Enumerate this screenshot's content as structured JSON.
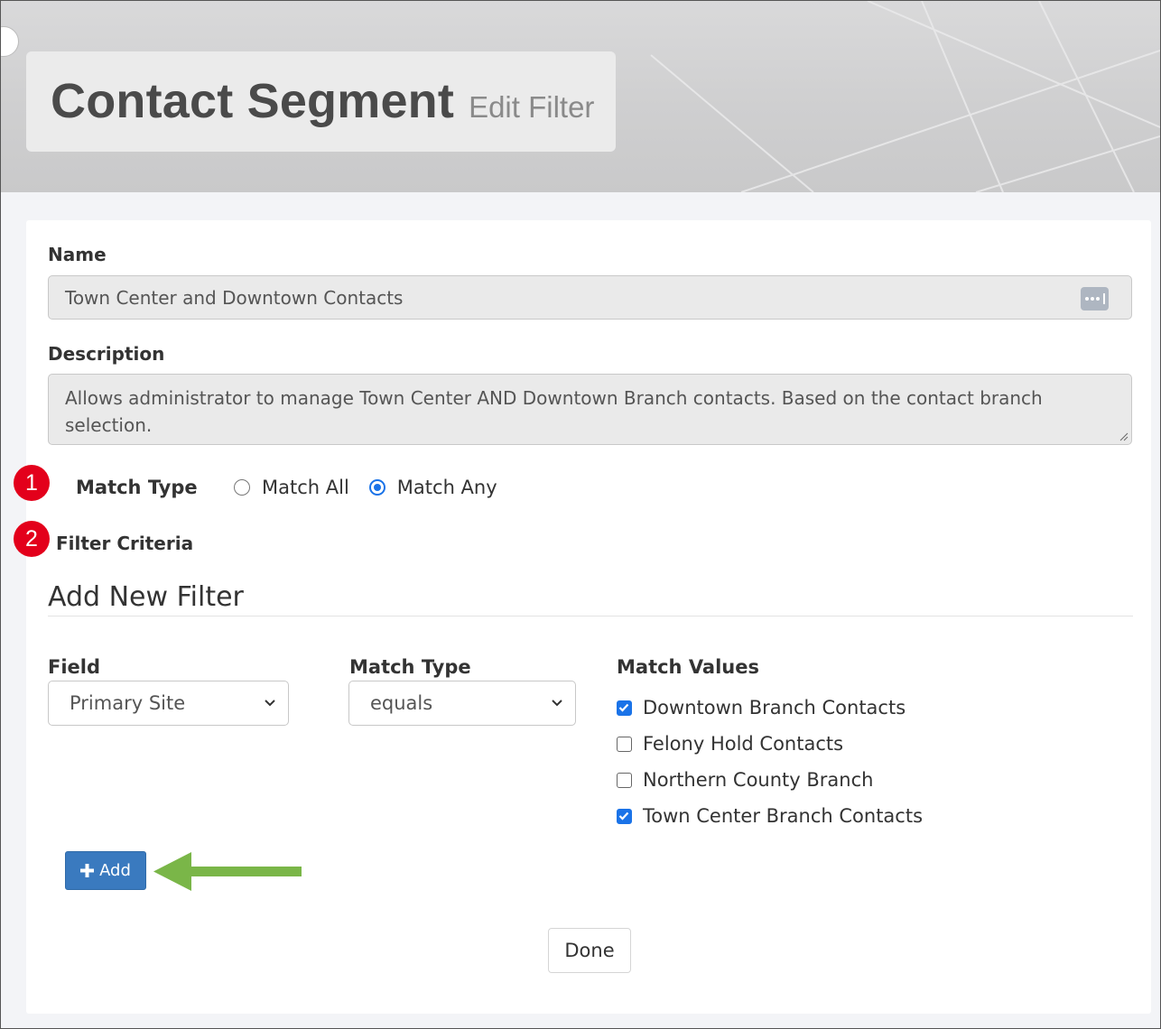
{
  "header": {
    "title": "Contact Segment",
    "subtitle": "Edit Filter"
  },
  "form": {
    "name_label": "Name",
    "name_value": "Town Center and Downtown Contacts",
    "description_label": "Description",
    "description_value": "Allows administrator to manage Town Center AND Downtown Branch contacts. Based on the contact branch selection.",
    "match_type_label": "Match Type",
    "match_type_options": [
      {
        "label": "Match All",
        "checked": false
      },
      {
        "label": "Match Any",
        "checked": true
      }
    ],
    "filter_criteria_label": "Filter Criteria"
  },
  "badges": [
    "1",
    "2"
  ],
  "new_filter": {
    "heading": "Add New Filter",
    "field_label": "Field",
    "field_value": "Primary Site",
    "match_type_label": "Match Type",
    "match_type_value": "equals",
    "match_values_label": "Match Values",
    "match_values": [
      {
        "label": "Downtown Branch Contacts",
        "checked": true
      },
      {
        "label": "Felony Hold Contacts",
        "checked": false
      },
      {
        "label": "Northern County Branch",
        "checked": false
      },
      {
        "label": "Town Center Branch Contacts",
        "checked": true
      }
    ],
    "add_label": "Add"
  },
  "footer": {
    "done_label": "Done"
  },
  "colors": {
    "accent": "#1a73e8",
    "badge": "#e3001b",
    "add_button": "#3a7abf",
    "arrow": "#7ab648"
  },
  "icons": [
    "password-manager-icon",
    "chevron-down-icon",
    "plus-icon",
    "resize-grip-icon",
    "arrow-left-icon"
  ]
}
